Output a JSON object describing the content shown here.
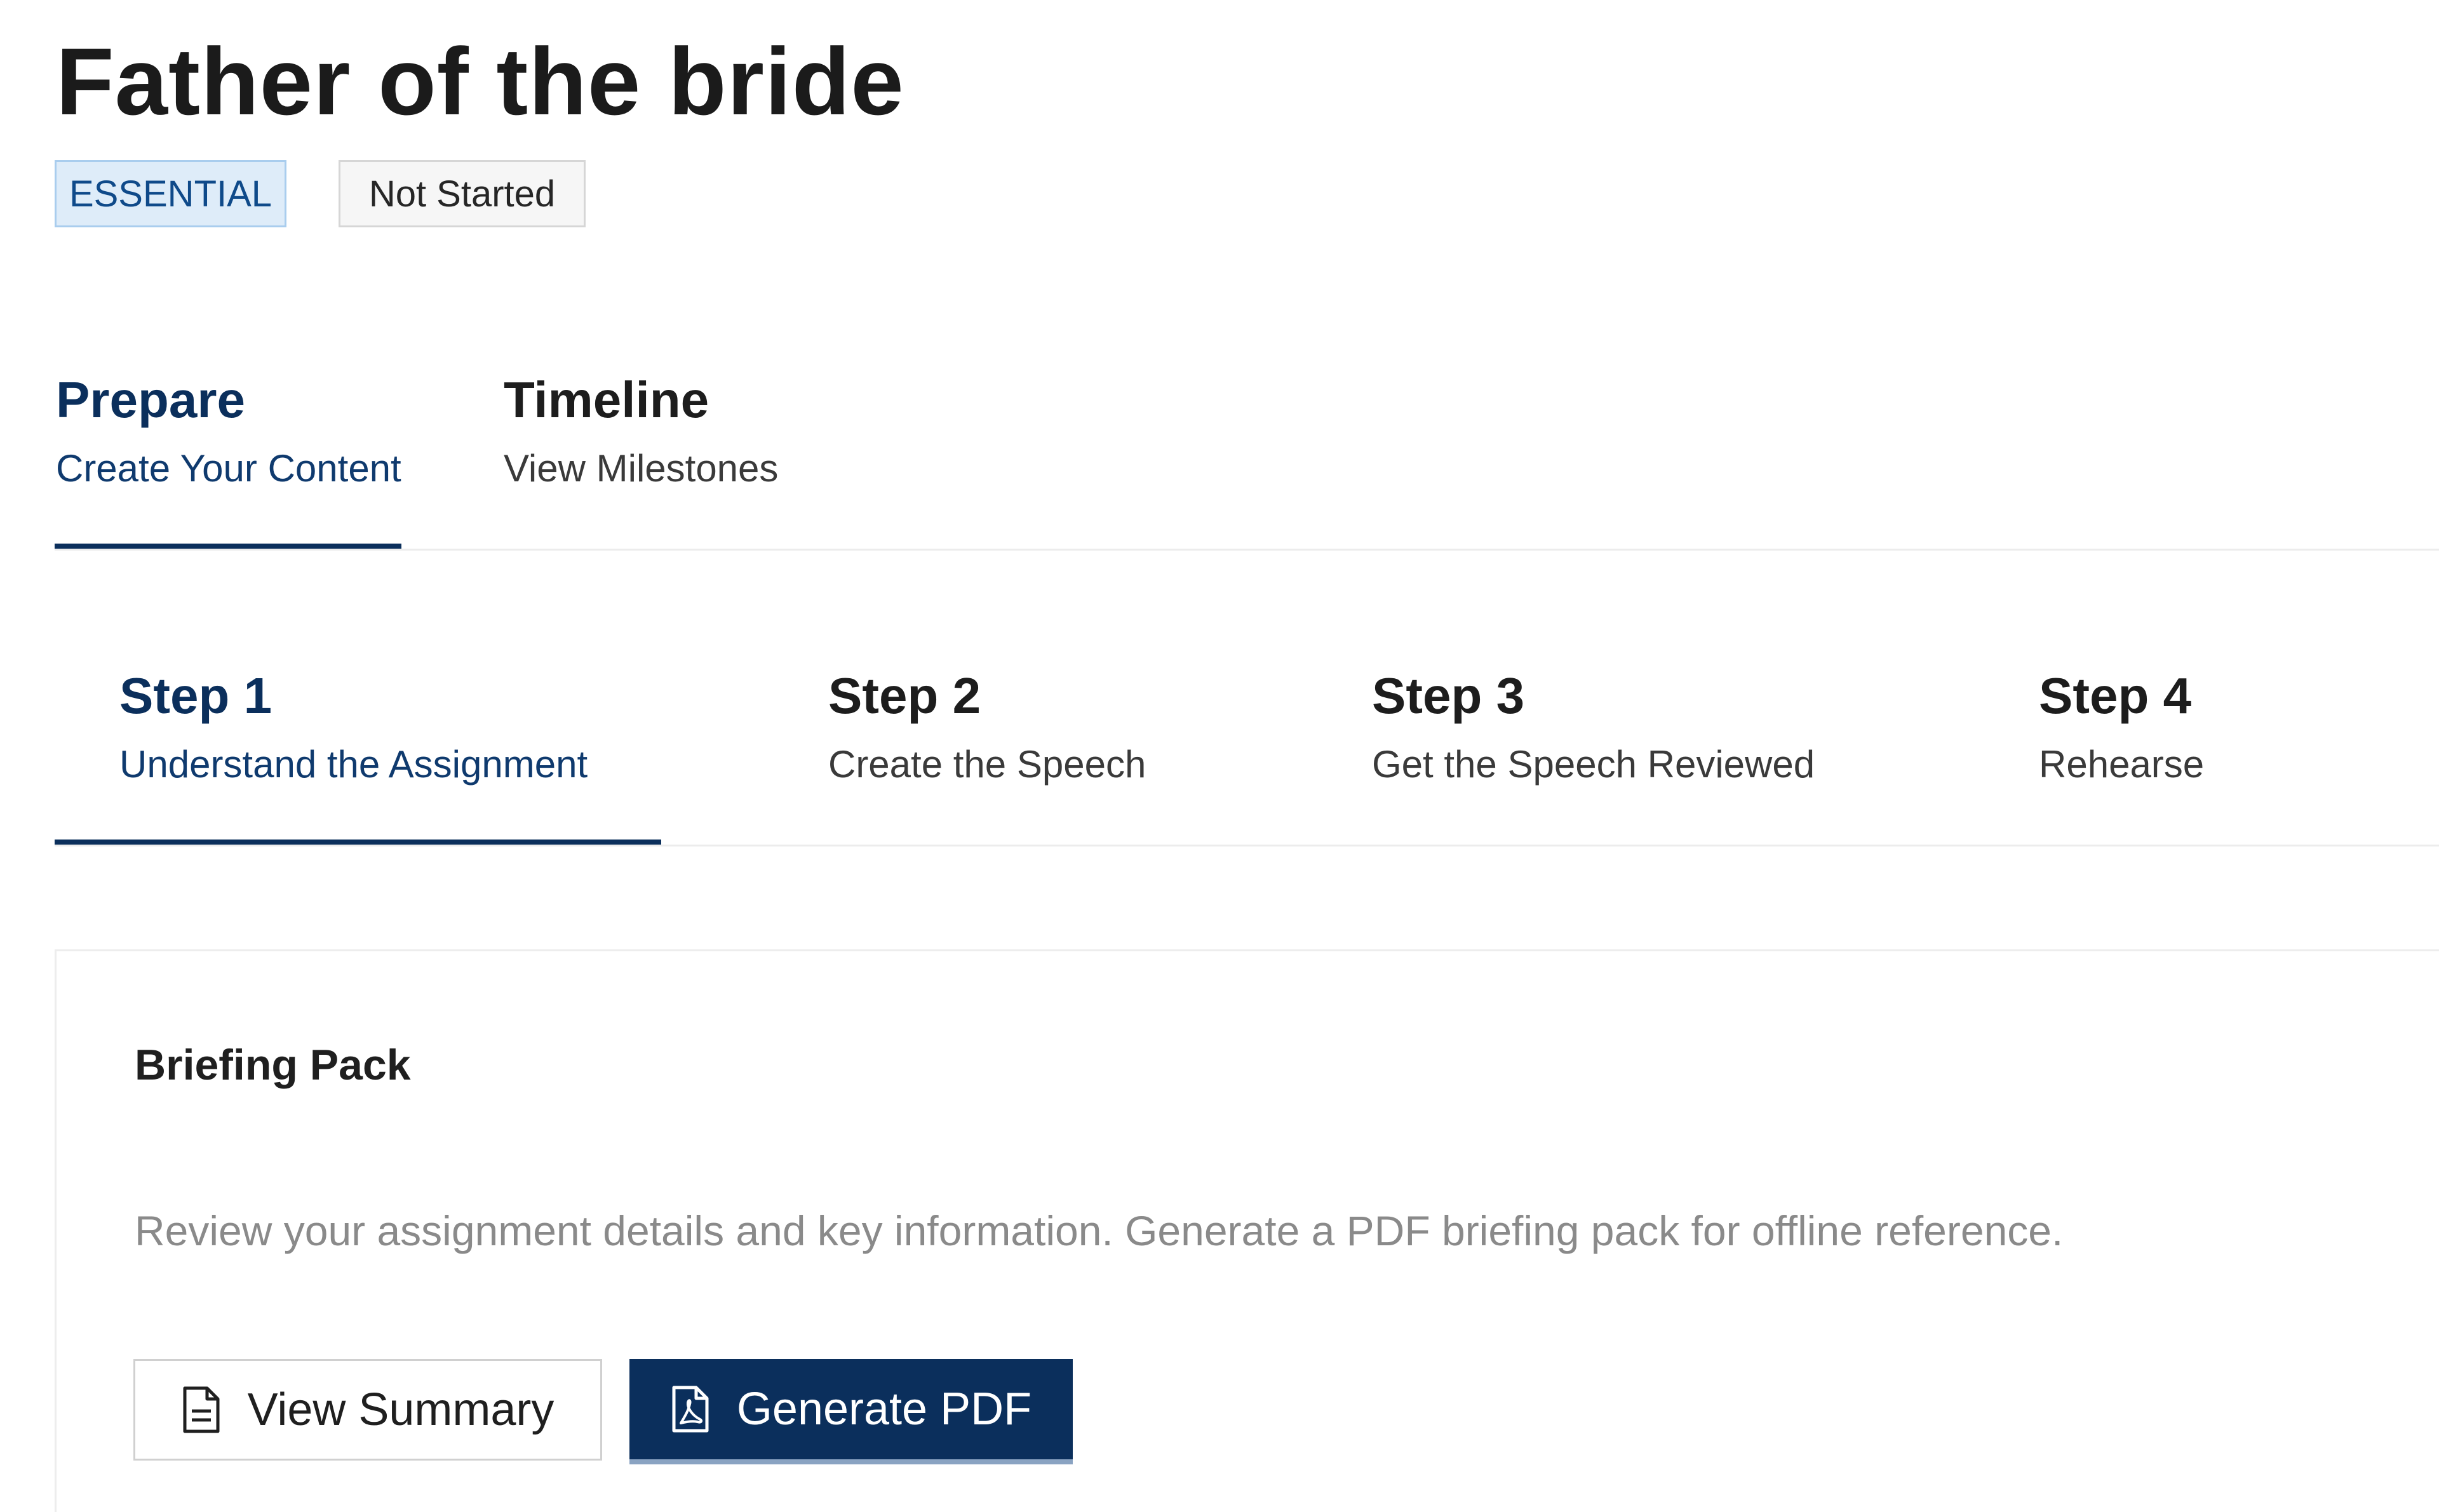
{
  "header": {
    "title": "Father of the bride",
    "tags": {
      "priority": "ESSENTIAL",
      "status": "Not Started"
    }
  },
  "main_tabs": [
    {
      "title": "Prepare",
      "subtitle": "Create Your Content",
      "active": true
    },
    {
      "title": "Timeline",
      "subtitle": "View Milestones",
      "active": false
    }
  ],
  "steps": [
    {
      "title": "Step 1",
      "subtitle": "Understand the Assignment",
      "active": true
    },
    {
      "title": "Step 2",
      "subtitle": "Create the Speech",
      "active": false
    },
    {
      "title": "Step 3",
      "subtitle": "Get the Speech Reviewed",
      "active": false
    },
    {
      "title": "Step 4",
      "subtitle": "Rehearse",
      "active": false
    }
  ],
  "briefing": {
    "title": "Briefing Pack",
    "description": "Review your assignment details and key information. Generate a PDF briefing pack for offline reference.",
    "view_summary_label": "View Summary",
    "view_summary_icon": "document-icon",
    "generate_pdf_label": "Generate PDF",
    "generate_pdf_icon": "pdf-file-icon"
  },
  "colors": {
    "accent": "#0b2f5c",
    "essential_bg": "#deecf9",
    "essential_text": "#0f4a8a",
    "muted_text": "#8a8a8a"
  }
}
